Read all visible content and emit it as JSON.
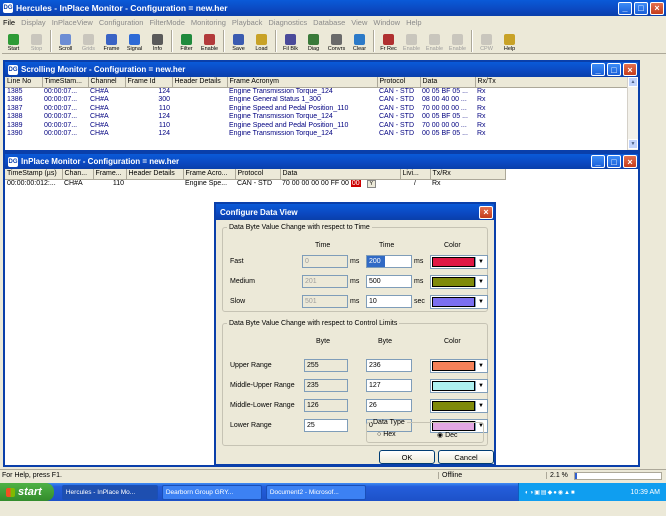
{
  "app": {
    "title": "Hercules - InPlace Monitor  - Configuration = new.her",
    "win_controls": [
      "_",
      "□",
      "×"
    ]
  },
  "menu": [
    "File",
    "Display",
    "InPlaceView",
    "Configuration",
    "FilterMode",
    "Monitoring",
    "Playback",
    "Diagnostics",
    "Database",
    "View",
    "Window",
    "Help"
  ],
  "toolbar": [
    {
      "label": "Start",
      "icon": "play-icon",
      "disabled": false,
      "color": "#2e9b36"
    },
    {
      "label": "Stop",
      "icon": "stop-icon",
      "disabled": true,
      "color": "#c9c6bd"
    },
    {
      "label": "Scroll",
      "icon": "scroll-icon",
      "disabled": false,
      "color": "#6c8dd4"
    },
    {
      "label": "Grids",
      "icon": "grid-icon",
      "disabled": true,
      "color": "#c9c6bd"
    },
    {
      "label": "Frame",
      "icon": "frame-icon",
      "disabled": false,
      "color": "#3a63c5"
    },
    {
      "label": "Signal",
      "icon": "signal-icon",
      "disabled": false,
      "color": "#2d6ad6"
    },
    {
      "label": "Info",
      "icon": "info-icon",
      "disabled": false,
      "color": "#5a5a5a"
    },
    {
      "label": "Filter",
      "icon": "filter-icon",
      "disabled": false,
      "color": "#1f8a3c"
    },
    {
      "label": "Enable",
      "icon": "enable-icon",
      "disabled": false,
      "color": "#b23a3a"
    },
    {
      "label": "Save",
      "icon": "save-icon",
      "disabled": false,
      "color": "#3b5bb0"
    },
    {
      "label": "Load",
      "icon": "load-icon",
      "disabled": false,
      "color": "#c8a227"
    },
    {
      "label": "Fil Blk",
      "icon": "filter-block-icon",
      "disabled": false,
      "color": "#4a4a9a"
    },
    {
      "label": "Diag",
      "icon": "diag-icon",
      "disabled": false,
      "color": "#3a7a3a"
    },
    {
      "label": "Convrs",
      "icon": "convert-icon",
      "disabled": false,
      "color": "#6a6a6a"
    },
    {
      "label": "Clear",
      "icon": "clear-icon",
      "disabled": false,
      "color": "#2c7ac8"
    },
    {
      "label": "Fr Rec",
      "icon": "frame-record-icon",
      "disabled": false,
      "color": "#b03030"
    },
    {
      "label": "Enable",
      "icon": "enable-icon",
      "disabled": true,
      "color": "#c9c6bd"
    },
    {
      "label": "Enable",
      "icon": "enable-icon",
      "disabled": true,
      "color": "#c9c6bd"
    },
    {
      "label": "Enable",
      "icon": "enable-icon",
      "disabled": true,
      "color": "#c9c6bd"
    },
    {
      "label": "CPW",
      "icon": "cpw-icon",
      "disabled": true,
      "color": "#c9c6bd"
    },
    {
      "label": "Help",
      "icon": "help-icon",
      "disabled": false,
      "color": "#c8a227"
    }
  ],
  "scrolling_monitor": {
    "title": "Scrolling Monitor  - Configuration = new.her",
    "columns": [
      "Line No",
      "TimeStam...",
      "Channel",
      "Frame Id",
      "Header Details",
      "Frame Acronym",
      "Protocol",
      "Data",
      "Rx/Tx"
    ],
    "rows": [
      [
        "1385",
        "00:00:07...",
        "CH#A",
        "124",
        "",
        "Engine Transmission Torque_124",
        "CAN - STD",
        "00 05 BF 05 ...",
        "Rx"
      ],
      [
        "1386",
        "00:00:07...",
        "CH#A",
        "300",
        "",
        "Engine General Status 1_300",
        "CAN - STD",
        "08 00 40 00 ...",
        "Rx"
      ],
      [
        "1387",
        "00:00:07...",
        "CH#A",
        "110",
        "",
        "Engine Speed and Pedal Position_110",
        "CAN - STD",
        "70 00 00 00 ...",
        "Rx"
      ],
      [
        "1388",
        "00:00:07...",
        "CH#A",
        "124",
        "",
        "Engine Transmission Torque_124",
        "CAN - STD",
        "00 05 BF 05 ...",
        "Rx"
      ],
      [
        "1389",
        "00:00:07...",
        "CH#A",
        "110",
        "",
        "Engine Speed and Pedal Position_110",
        "CAN - STD",
        "70 00 00 00 ...",
        "Rx"
      ],
      [
        "1390",
        "00:00:07...",
        "CH#A",
        "124",
        "",
        "Engine Transmission Torque_124",
        "CAN - STD",
        "00 05 BF 05 ...",
        "Rx"
      ]
    ]
  },
  "inplace_monitor": {
    "title": "InPlace Monitor  - Configuration = new.her",
    "columns": [
      "TimeStamp (µs)",
      "Chan...",
      "Frame...",
      "Header Details",
      "Frame Acro...",
      "Protocol",
      "Data",
      "Livi...",
      "Tx/Rx"
    ],
    "row": [
      "00:00:00:012:...",
      "CH#A",
      "110",
      "",
      "Engine Spe...",
      "CAN - STD",
      "70 00 00 00 00 FF 00",
      "Y",
      "/",
      "Rx"
    ],
    "highlight_byte": "00",
    "highlight_color": "#cc0000"
  },
  "dialog": {
    "title": "Configure Data View",
    "time_group": {
      "legend": "Data Byte Value Change with respect to Time",
      "col_time1": "Time",
      "col_time2": "Time",
      "col_color": "Color",
      "rows": [
        {
          "label": "Fast",
          "disabled_val": "0",
          "unit1": "ms",
          "value": "200",
          "unit2": "ms",
          "color": "#e01744"
        },
        {
          "label": "Medium",
          "disabled_val": "201",
          "unit1": "ms",
          "value": "500",
          "unit2": "ms",
          "color": "#7f8a0a"
        },
        {
          "label": "Slow",
          "disabled_val": "501",
          "unit1": "ms",
          "value": "10",
          "unit2": "sec",
          "color": "#7b6ff0"
        }
      ]
    },
    "limits_group": {
      "legend": "Data Byte Value Change with respect to Control Limits",
      "col_byte1": "Byte",
      "col_byte2": "Byte",
      "col_color": "Color",
      "rows": [
        {
          "label": "Upper Range",
          "val1": "255",
          "val2": "236",
          "color": "#f58159"
        },
        {
          "label": "Middle-Upper Range",
          "val1": "235",
          "val2": "127",
          "color": "#aef1f0"
        },
        {
          "label": "Middle-Lower Range",
          "val1": "126",
          "val2": "26",
          "color": "#7f8a0a"
        },
        {
          "label": "Lower Range",
          "val1": "25",
          "val2": "0",
          "color": "#e3a7e3"
        }
      ]
    },
    "data_type": {
      "legend": "Data Type",
      "hex": "Hex",
      "dec": "Dec",
      "selected": "Dec"
    },
    "ok_label": "OK",
    "cancel_label": "Cancel"
  },
  "statusbar": {
    "help_text": "For Help, press F1.",
    "offline": "Offline",
    "percent": "2.1 %"
  },
  "taskbar": {
    "start_label": "start",
    "tasks": [
      "Hercules - InPlace Mo...",
      "Dearborn Group GRY...",
      "Document2 - Microsof..."
    ],
    "clock": "10:39 AM"
  }
}
